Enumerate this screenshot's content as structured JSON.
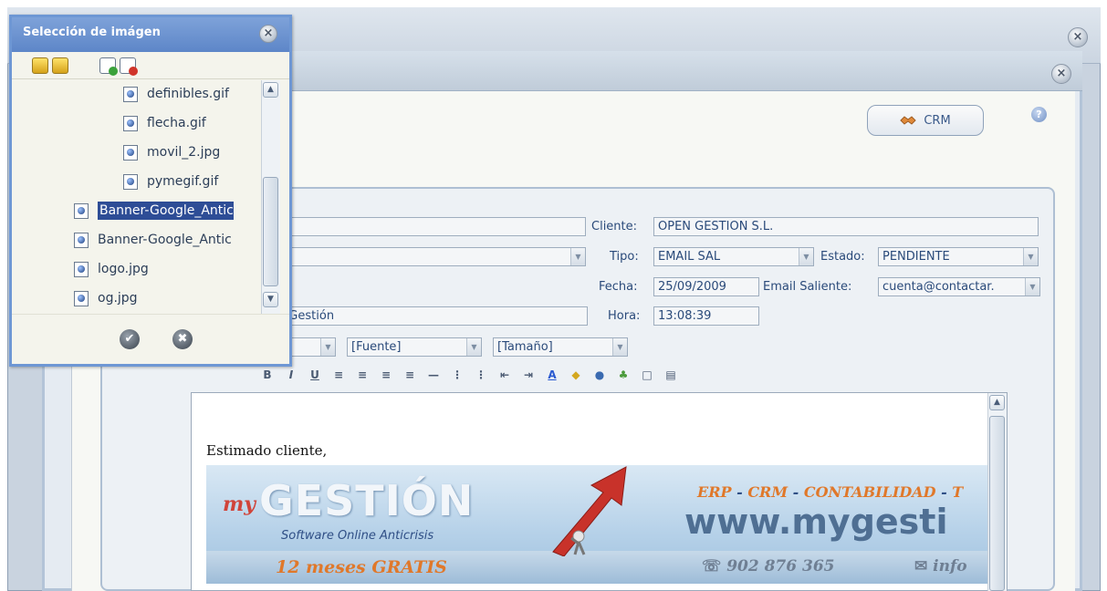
{
  "popup": {
    "title": "Selección de imágen",
    "close_label": "×",
    "files": [
      {
        "name": "definibles.gif",
        "indent": 2,
        "selected": false
      },
      {
        "name": "flecha.gif",
        "indent": 2,
        "selected": false
      },
      {
        "name": "movil_2.jpg",
        "indent": 2,
        "selected": false
      },
      {
        "name": "pymegif.gif",
        "indent": 2,
        "selected": false
      },
      {
        "name": "Banner-Google_Antic",
        "indent": 1,
        "selected": true
      },
      {
        "name": "Banner-Google_Antic",
        "indent": 1,
        "selected": false
      },
      {
        "name": "logo.jpg",
        "indent": 1,
        "selected": false
      },
      {
        "name": "og.jpg",
        "indent": 1,
        "selected": false
      }
    ],
    "ok_label": "✔",
    "cancel_label": "✖"
  },
  "dialog": {
    "crm_button": "CRM",
    "help_label": "?",
    "close_label": "×"
  },
  "form": {
    "cliente_label": "Cliente:",
    "cliente_value": "OPEN GESTION S.L.",
    "tipo_label": "Tipo:",
    "tipo_value": "EMAIL SAL",
    "estado_label": "Estado:",
    "estado_value": "PENDIENTE",
    "fecha_label": "Fecha:",
    "fecha_value": "25/09/2009",
    "email_label": "Email Saliente:",
    "email_value": "cuenta@contactar.",
    "hora_label": "Hora:",
    "hora_value": "13:08:39",
    "asunto_value": "lyGestión",
    "fuente_value": "[Fuente]",
    "tamano_value": "[Tamaño]"
  },
  "toolbar": [
    "B",
    "I",
    "U",
    "≡",
    "≡",
    "≡",
    "≡",
    "—",
    "⋮",
    "⋮",
    "⇤",
    "⇥",
    "A",
    "◆",
    "●",
    "♣",
    "□",
    "▤"
  ],
  "editor": {
    "greeting": "Estimado cliente,",
    "banner": {
      "logo_prefix": "my",
      "logo_main": "GESTIÓN",
      "tagline": "Software Online Anticrisis",
      "promo": "12 meses GRATIS",
      "products_a": "ERP",
      "products_b": "CRM",
      "products_c": "CONTABILIDAD",
      "products_d": "T",
      "url": "www.mygesti",
      "phone": "902 876 365",
      "email_partial": "info"
    }
  },
  "colors": {
    "accent": "#6e97d4",
    "selected": "#2e4d96",
    "banner_orange": "#e0782a"
  }
}
